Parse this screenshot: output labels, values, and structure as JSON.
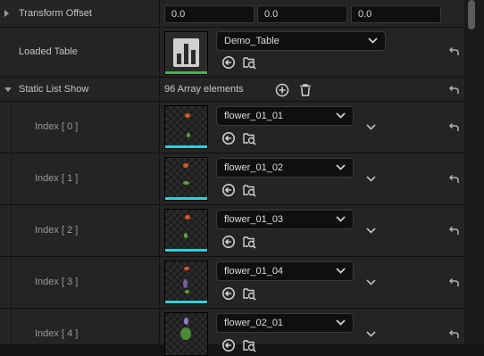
{
  "transform_offset": {
    "label": "Transform Offset",
    "x": "0.0",
    "y": "0.0",
    "z": "0.0"
  },
  "loaded_table": {
    "label": "Loaded Table",
    "value": "Demo_Table"
  },
  "static_list": {
    "label": "Static List Show",
    "count_text": "96 Array elements"
  },
  "items": [
    {
      "index_label": "Index [ 0 ]",
      "value": "flower_01_01"
    },
    {
      "index_label": "Index [ 1 ]",
      "value": "flower_01_02"
    },
    {
      "index_label": "Index [ 2 ]",
      "value": "flower_01_03"
    },
    {
      "index_label": "Index [ 3 ]",
      "value": "flower_01_04"
    },
    {
      "index_label": "Index [ 4 ]",
      "value": "flower_02_01"
    }
  ],
  "colors": {
    "table_bar": "#4caf50",
    "texture_bar": "#27d3e0",
    "bg": "#242424"
  },
  "icons": [
    "expand-arrow-icon",
    "table-icon",
    "chevron-down-icon",
    "use-selected-icon",
    "browse-icon",
    "add-element-icon",
    "delete-icon",
    "reset-arrow-icon"
  ]
}
